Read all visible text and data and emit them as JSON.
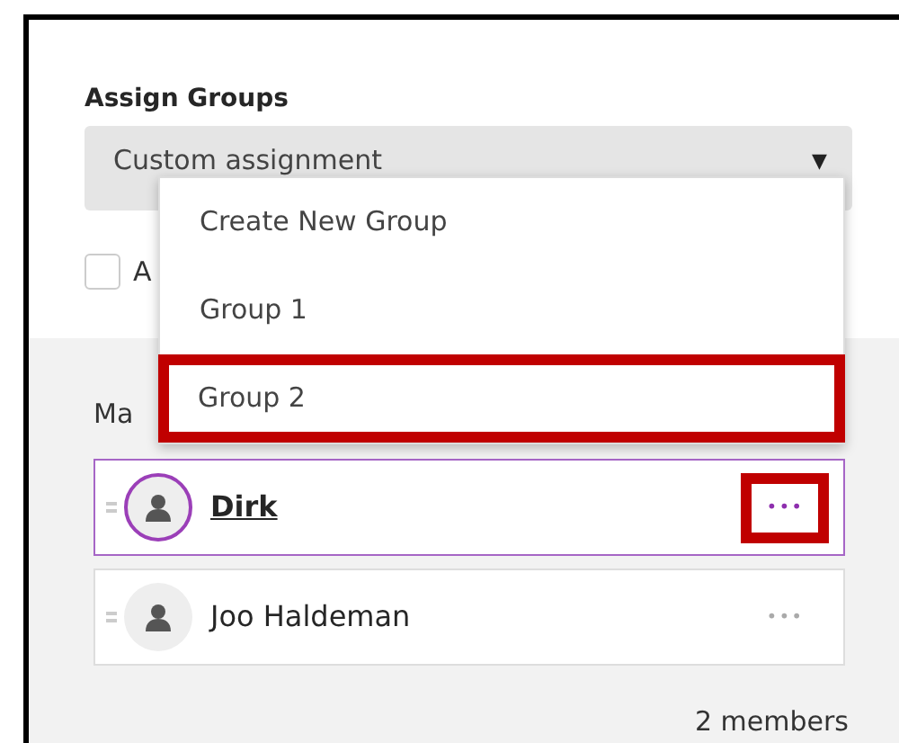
{
  "assign_groups": {
    "label": "Assign Groups",
    "select_value": "Custom assignment",
    "caret": "▼",
    "dropdown_open": true
  },
  "dropdown_items": [
    {
      "label": "Create New Group",
      "highlighted": false
    },
    {
      "label": "Group 1",
      "highlighted": false
    },
    {
      "label": "Group 2",
      "highlighted": true
    }
  ],
  "checkbox": {
    "label": "A",
    "checked": false
  },
  "members_heading": "Ma",
  "members": [
    {
      "name": "Dirk",
      "selected": true,
      "more_label": "•••",
      "more_highlighted": true
    },
    {
      "name": "Joo Haldeman",
      "selected": false,
      "more_label": "•••",
      "more_highlighted": false
    }
  ],
  "member_count": "2 members"
}
